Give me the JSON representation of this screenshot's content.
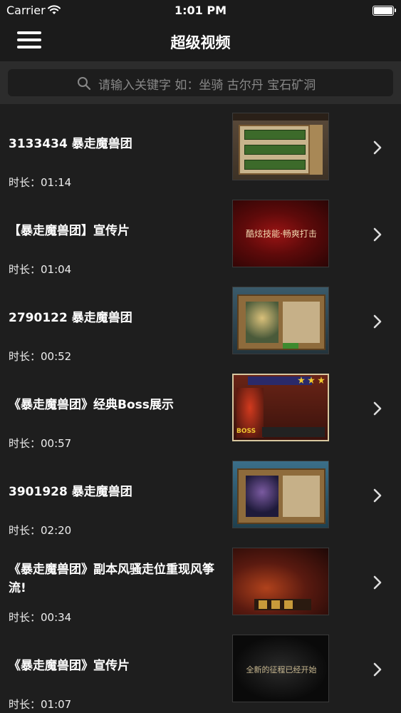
{
  "status_bar": {
    "carrier": "Carrier",
    "time": "1:01 PM"
  },
  "nav": {
    "title": "超级视频"
  },
  "search": {
    "placeholder": "请输入关键字 如：坐骑 古尔丹 宝石矿洞"
  },
  "videos": [
    {
      "title": "3133434 暴走魔兽团",
      "duration": "时长：01:14"
    },
    {
      "title": "【暴走魔兽团】宣传片",
      "duration": "时长：01:04"
    },
    {
      "title": "2790122 暴走魔兽团",
      "duration": "时长：00:52"
    },
    {
      "title": "《暴走魔兽团》经典Boss展示",
      "duration": "时长：00:57"
    },
    {
      "title": "3901928 暴走魔兽团",
      "duration": "时长：02:20"
    },
    {
      "title": "《暴走魔兽团》副本风骚走位重现风筝流!",
      "duration": "时长：00:34"
    },
    {
      "title": "《暴走魔兽团》宣传片",
      "duration": "时长：01:07"
    }
  ],
  "thumbnails": {
    "promo_1_text": "酷炫技能·畅爽打击",
    "promo_2_text": "全新的征程已经开始",
    "boss_label": "BOSS"
  },
  "colors": {
    "background": "#1e1e1e",
    "nav_background": "#1b1b1b",
    "search_area": "#2c2c2c",
    "text_primary": "#ffffff",
    "text_placeholder": "#888888"
  },
  "icons": {
    "menu": "hamburger-menu-icon",
    "search": "magnifier-icon",
    "row_accessory": "chevron-right-icon",
    "wifi": "wifi-icon",
    "battery": "battery-icon"
  }
}
